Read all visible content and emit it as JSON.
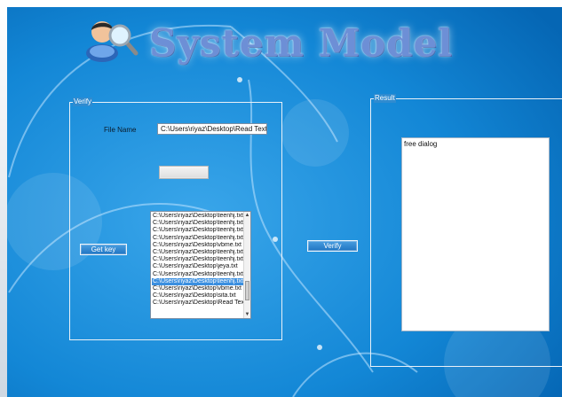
{
  "header": {
    "title": "System Model"
  },
  "verify_group": {
    "legend": "Verify",
    "file_name_label": "File Name",
    "file_name_value": "C:\\Users\\riyaz\\Desktop\\Read Text.txt",
    "browse_button_label": "",
    "get_key_label": "Get key",
    "file_list": [
      "C:\\Users\\riyaz\\Desktop\\teenhj.txt",
      "C:\\Users\\riyaz\\Desktop\\teenhj.txt",
      "C:\\Users\\riyaz\\Desktop\\teenhj.txt",
      "C:\\Users\\riyaz\\Desktop\\teenhj.txt",
      "C:\\Users\\riyaz\\Desktop\\vbme.txt",
      "C:\\Users\\riyaz\\Desktop\\teenhj.txt",
      "C:\\Users\\riyaz\\Desktop\\teenhj.txt",
      "C:\\Users\\riyaz\\Desktop\\jeya.txt",
      "C:\\Users\\riyaz\\Desktop\\teenhj.txt",
      "C:\\Users\\riyaz\\Desktop\\teenhj.txt",
      "C:\\Users\\riyaz\\Desktop\\vbme.txt",
      "C:\\Users\\riyaz\\Desktop\\sita.txt",
      "C:\\Users\\riyaz\\Desktop\\Read Text.txt"
    ],
    "selected_index": 9
  },
  "verify_button_label": "Verify",
  "result_group": {
    "legend": "Result",
    "text": "free dialog"
  },
  "colors": {
    "background": "#0a78c8",
    "title": "#6d8fd6",
    "selection": "#3b8fe0"
  }
}
